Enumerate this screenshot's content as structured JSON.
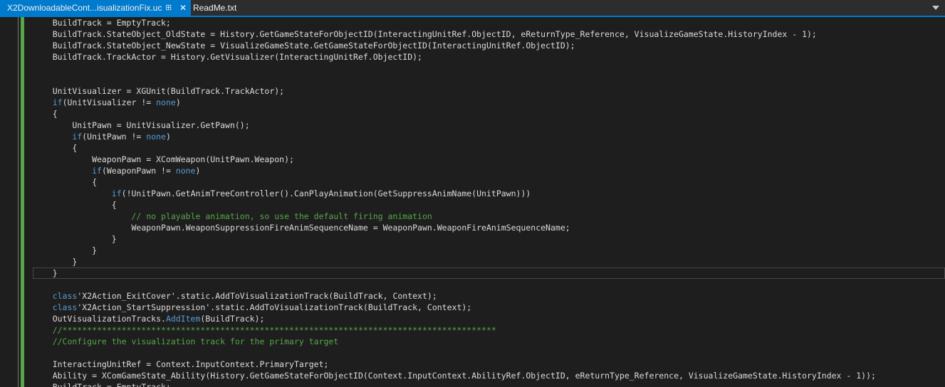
{
  "tabs": [
    {
      "label": "X2DownloadableCont...isualizationFix.uc",
      "active": true
    },
    {
      "label": "ReadMe.txt",
      "active": false
    }
  ],
  "tab_icons": {
    "pin": "pin-icon",
    "close": "close-icon",
    "overflow": "chevron-down-icon"
  },
  "colors": {
    "accent": "#007acc",
    "background": "#1e1e1e",
    "keyword": "#569cd6",
    "comment": "#57a64a",
    "text": "#dcdcdc",
    "change_bar": "#57a64a"
  },
  "code": {
    "lines": [
      [
        {
          "t": "    BuildTrack = EmptyTrack;",
          "c": "tx"
        }
      ],
      [
        {
          "t": "    BuildTrack.StateObject_OldState = History.GetGameStateForObjectID(InteractingUnitRef.ObjectID, eReturnType_Reference, VisualizeGameState.HistoryIndex - 1);",
          "c": "tx"
        }
      ],
      [
        {
          "t": "    BuildTrack.StateObject_NewState = VisualizeGameState.GetGameStateForObjectID(InteractingUnitRef.ObjectID);",
          "c": "tx"
        }
      ],
      [
        {
          "t": "    BuildTrack.TrackActor = History.GetVisualizer(InteractingUnitRef.ObjectID);",
          "c": "tx"
        }
      ],
      [
        {
          "t": "",
          "c": "tx"
        }
      ],
      [
        {
          "t": "",
          "c": "tx"
        }
      ],
      [
        {
          "t": "    UnitVisualizer = XGUnit(BuildTrack.TrackActor);",
          "c": "tx"
        }
      ],
      [
        {
          "t": "    ",
          "c": "tx"
        },
        {
          "t": "if",
          "c": "kw"
        },
        {
          "t": "(UnitVisualizer != ",
          "c": "tx"
        },
        {
          "t": "none",
          "c": "kw"
        },
        {
          "t": ")",
          "c": "tx"
        }
      ],
      [
        {
          "t": "    {",
          "c": "tx"
        }
      ],
      [
        {
          "t": "        UnitPawn = UnitVisualizer.GetPawn();",
          "c": "tx"
        }
      ],
      [
        {
          "t": "        ",
          "c": "tx"
        },
        {
          "t": "if",
          "c": "kw"
        },
        {
          "t": "(UnitPawn != ",
          "c": "tx"
        },
        {
          "t": "none",
          "c": "kw"
        },
        {
          "t": ")",
          "c": "tx"
        }
      ],
      [
        {
          "t": "        {",
          "c": "tx"
        }
      ],
      [
        {
          "t": "            WeaponPawn = XComWeapon(UnitPawn.Weapon);",
          "c": "tx"
        }
      ],
      [
        {
          "t": "            ",
          "c": "tx"
        },
        {
          "t": "if",
          "c": "kw"
        },
        {
          "t": "(WeaponPawn != ",
          "c": "tx"
        },
        {
          "t": "none",
          "c": "kw"
        },
        {
          "t": ")",
          "c": "tx"
        }
      ],
      [
        {
          "t": "            {",
          "c": "tx"
        }
      ],
      [
        {
          "t": "                ",
          "c": "tx"
        },
        {
          "t": "if",
          "c": "kw"
        },
        {
          "t": "(!UnitPawn.GetAnimTreeController().CanPlayAnimation(GetSuppressAnimName(UnitPawn)))",
          "c": "tx"
        }
      ],
      [
        {
          "t": "                {",
          "c": "tx"
        }
      ],
      [
        {
          "t": "                    ",
          "c": "tx"
        },
        {
          "t": "// no playable animation, so use the default firing animation",
          "c": "cm"
        }
      ],
      [
        {
          "t": "                    WeaponPawn.WeaponSuppressionFireAnimSequenceName = WeaponPawn.WeaponFireAnimSequenceName;",
          "c": "tx"
        }
      ],
      [
        {
          "t": "                }",
          "c": "tx"
        }
      ],
      [
        {
          "t": "            }",
          "c": "tx"
        }
      ],
      [
        {
          "t": "        }",
          "c": "tx"
        }
      ],
      [
        {
          "t": "    }",
          "c": "tx"
        }
      ],
      [
        {
          "t": "",
          "c": "tx"
        }
      ],
      [
        {
          "t": "    ",
          "c": "tx"
        },
        {
          "t": "class",
          "c": "kw"
        },
        {
          "t": "'X2Action_ExitCover'.static.AddToVisualizationTrack(BuildTrack, Context);",
          "c": "tx"
        }
      ],
      [
        {
          "t": "    ",
          "c": "tx"
        },
        {
          "t": "class",
          "c": "kw"
        },
        {
          "t": "'X2Action_StartSuppression'.static.AddToVisualizationTrack(BuildTrack, Context);",
          "c": "tx"
        }
      ],
      [
        {
          "t": "    OutVisualizationTracks.",
          "c": "tx"
        },
        {
          "t": "AddItem",
          "c": "kw"
        },
        {
          "t": "(BuildTrack);",
          "c": "tx"
        }
      ],
      [
        {
          "t": "    //****************************************************************************************",
          "c": "cm"
        }
      ],
      [
        {
          "t": "    //Configure the visualization track for the primary target",
          "c": "cm"
        }
      ],
      [
        {
          "t": "",
          "c": "tx"
        }
      ],
      [
        {
          "t": "    InteractingUnitRef = Context.InputContext.PrimaryTarget;",
          "c": "tx"
        }
      ],
      [
        {
          "t": "    Ability = XComGameState_Ability(History.GetGameStateForObjectID(Context.InputContext.AbilityRef.ObjectID, eReturnType_Reference, VisualizeGameState.HistoryIndex - 1));",
          "c": "tx"
        }
      ],
      [
        {
          "t": "    BuildTrack = EmptyTrack;",
          "c": "tx"
        }
      ]
    ],
    "current_line_index": 22
  }
}
